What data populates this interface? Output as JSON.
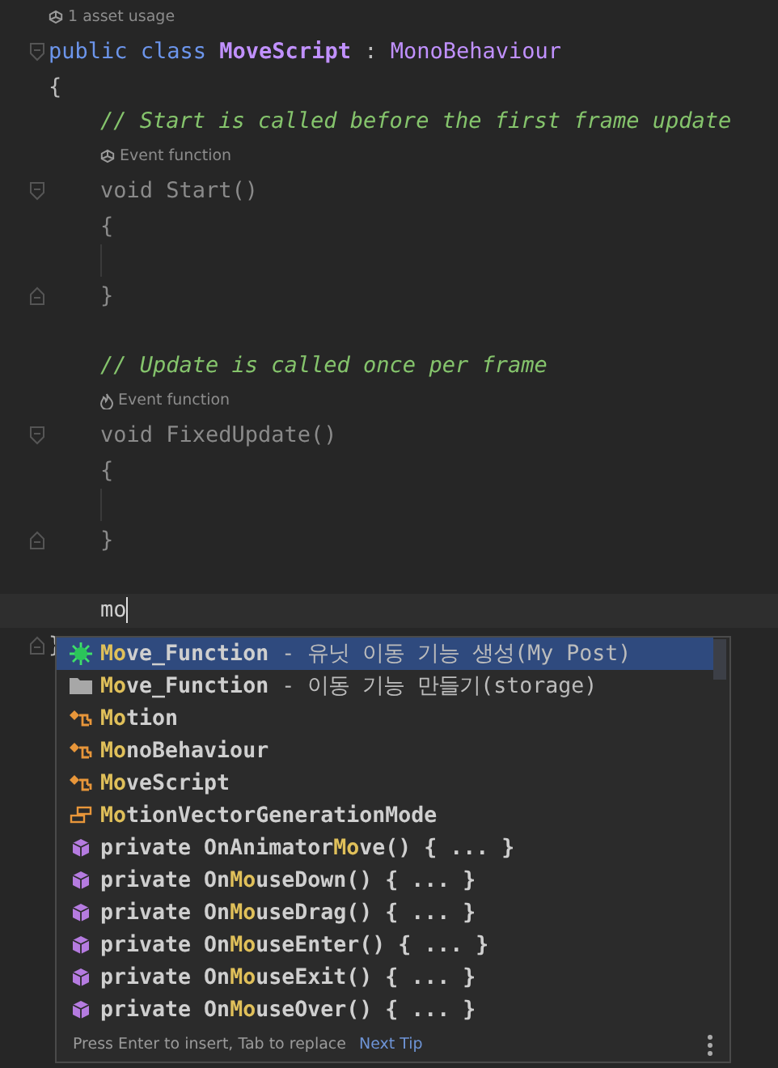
{
  "editor": {
    "header": [
      {
        "kind": "hint",
        "text": "1 asset usage"
      },
      {
        "kind": "open",
        "tokens": [
          {
            "kind": "keyword",
            "text": "public class "
          },
          {
            "kind": "class",
            "text": "MoveScript"
          },
          {
            "kind": "plain",
            "text": " : "
          },
          {
            "kind": "type",
            "text": "MonoBehaviour"
          }
        ]
      },
      {
        "kind": "code",
        "tokens": [
          {
            "kind": "plain",
            "text": "{"
          }
        ]
      }
    ],
    "body": [
      {
        "kind": "code",
        "tokens": [
          {
            "kind": "comment",
            "text": "// Start is called before the first frame update"
          }
        ]
      },
      {
        "kind": "hint",
        "text": "Event function"
      },
      {
        "kind": "open",
        "tokens": [
          {
            "kind": "dim",
            "text": "void Start()"
          }
        ]
      },
      {
        "kind": "code",
        "tokens": [
          {
            "kind": "dim",
            "text": "{"
          }
        ]
      },
      {
        "kind": "guide"
      },
      {
        "kind": "close",
        "tokens": [
          {
            "kind": "dim",
            "text": "}"
          }
        ]
      },
      {
        "kind": "blank"
      },
      {
        "kind": "code",
        "tokens": [
          {
            "kind": "comment",
            "text": "// Update is called once per frame"
          }
        ]
      },
      {
        "kind": "flamehint",
        "text": "Event function"
      },
      {
        "kind": "open",
        "tokens": [
          {
            "kind": "dim",
            "text": "void FixedUpdate()"
          }
        ]
      },
      {
        "kind": "code",
        "tokens": [
          {
            "kind": "dim",
            "text": "{"
          }
        ]
      },
      {
        "kind": "guide"
      },
      {
        "kind": "close",
        "tokens": [
          {
            "kind": "dim",
            "text": "}"
          }
        ]
      },
      {
        "kind": "blank"
      },
      {
        "kind": "current",
        "tokens": [
          {
            "kind": "typed",
            "text": "mo"
          }
        ]
      }
    ],
    "footer": [
      {
        "kind": "close",
        "tokens": [
          {
            "kind": "plain",
            "text": "}"
          }
        ]
      }
    ]
  },
  "completion": {
    "items": [
      {
        "kind": "plugin",
        "text": "**Mo**ve_Function",
        "detail": " - 유닛 이동 기능 생성(My Post)",
        "selected": true
      },
      {
        "kind": "folder",
        "text": "**Mo**ve_Function",
        "detail": " - 이동 기능 만들기(storage)",
        "selected": false
      },
      {
        "kind": "class",
        "text": "**Mo**tion",
        "selected": false
      },
      {
        "kind": "class",
        "text": "**Mo**noBehaviour",
        "selected": false
      },
      {
        "kind": "class",
        "text": "**Mo**veScript",
        "selected": false
      },
      {
        "kind": "enum",
        "text": "**Mo**tionVectorGenerationMode",
        "selected": false
      },
      {
        "kind": "method",
        "text": "private OnAnimator**Mo**ve() { ... }",
        "selected": false
      },
      {
        "kind": "method",
        "text": "private On**Mo**useDown() { ... }",
        "selected": false
      },
      {
        "kind": "method",
        "text": "private On**Mo**useDrag() { ... }",
        "selected": false
      },
      {
        "kind": "method",
        "text": "private On**Mo**useEnter() { ... }",
        "selected": false
      },
      {
        "kind": "method",
        "text": "private On**Mo**useExit() { ... }",
        "selected": false
      },
      {
        "kind": "method",
        "text": "private On**Mo**useOver() { ... }",
        "selected": false
      }
    ],
    "footer": {
      "hint": "Press Enter to insert, Tab to replace",
      "link": "Next Tip"
    }
  }
}
